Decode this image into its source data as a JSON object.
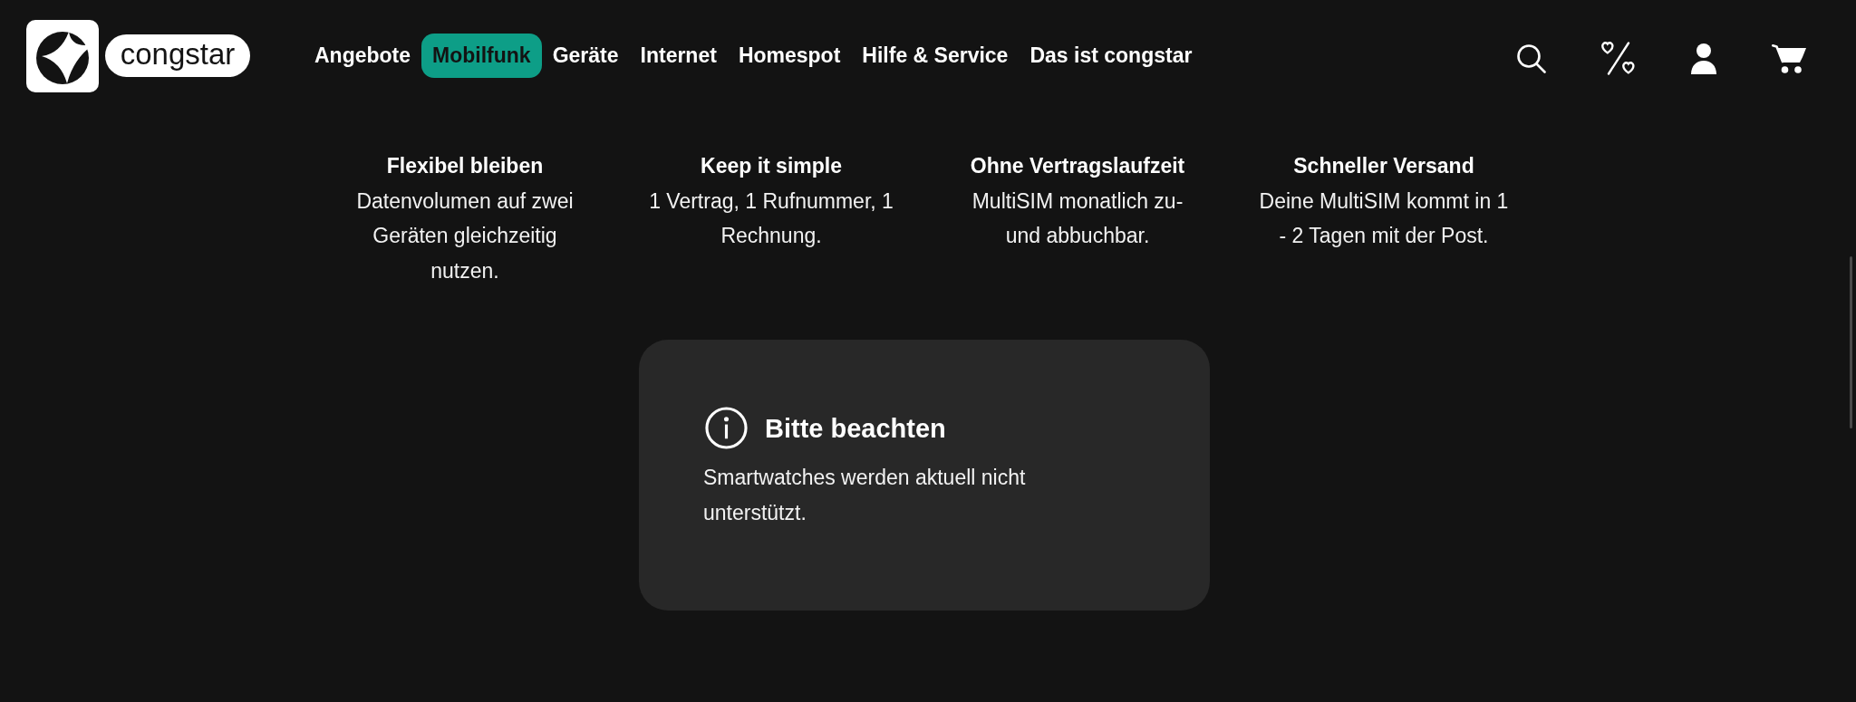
{
  "header": {
    "logo": {
      "wordmark": "congstar"
    },
    "nav": [
      {
        "label": "Angebote",
        "selected": false
      },
      {
        "label": "Mobilfunk",
        "selected": true
      },
      {
        "label": "Geräte",
        "selected": false
      },
      {
        "label": "Internet",
        "selected": false
      },
      {
        "label": "Homespot",
        "selected": false
      },
      {
        "label": "Hilfe & Service",
        "selected": false
      },
      {
        "label": "Das ist congstar",
        "selected": false
      }
    ]
  },
  "features": [
    {
      "title": "Flexibel bleiben",
      "text": "Datenvolumen auf zwei Geräten gleichzeitig nutzen."
    },
    {
      "title": "Keep it simple",
      "text": "1 Vertrag, 1 Rufnummer, 1 Rechnung."
    },
    {
      "title": "Ohne Vertragslaufzeit",
      "text": "MultiSIM monatlich zu- und abbuchbar."
    },
    {
      "title": "Schneller Versand",
      "text": "Deine MultiSIM kommt in 1 - 2 Tagen mit der Post."
    }
  ],
  "notice": {
    "title": "Bitte beachten",
    "text": "Smartwatches werden aktuell nicht unterstützt."
  }
}
